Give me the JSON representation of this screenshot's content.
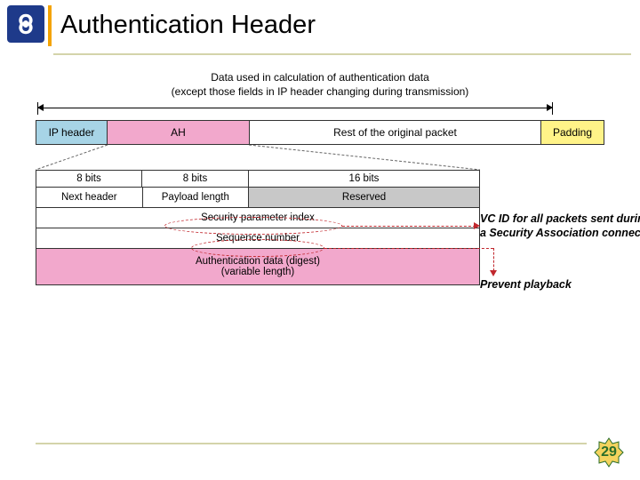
{
  "title": "Authentication Header",
  "range_caption_l1": "Data used in calculation of authentication data",
  "range_caption_l2": "(except those fields in IP header changing during transmission)",
  "packet": {
    "ip": "IP header",
    "ah": "AH",
    "rest": "Rest of the original packet",
    "pad": "Padding"
  },
  "bits": {
    "b8a": "8 bits",
    "b8b": "8 bits",
    "b16": "16 bits"
  },
  "ah_fields": {
    "next": "Next header",
    "paylen": "Payload length",
    "reserved": "Reserved",
    "spi": "Security parameter index",
    "seq": "Sequence number",
    "auth_l1": "Authentication data (digest)",
    "auth_l2": "(variable length)"
  },
  "annot": {
    "spi_l1": "VC ID for all packets sent during",
    "spi_l2": "a Security Association connection",
    "seq": "Prevent playback"
  },
  "page": "29"
}
